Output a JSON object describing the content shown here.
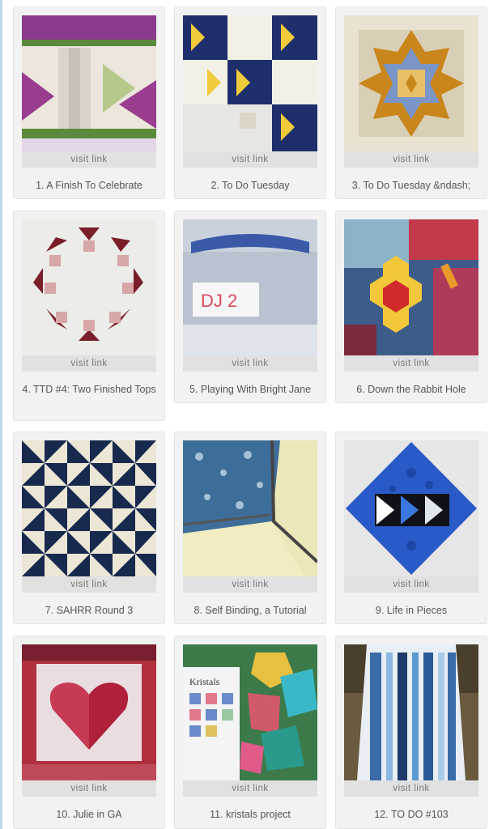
{
  "link_label": "visit link",
  "items": [
    {
      "caption": "1. A Finish To Celebrate",
      "thumb": "quilt-photo"
    },
    {
      "caption": "2. To Do Tuesday",
      "thumb": "quilt-photo"
    },
    {
      "caption": "3. To Do Tuesday &ndash;",
      "thumb": "quilt-photo"
    },
    {
      "caption": "4. TTD #4: Two Finished Tops",
      "thumb": "quilt-photo"
    },
    {
      "caption": "5. Playing With Bright Jane",
      "thumb": "storage-box-photo"
    },
    {
      "caption": "6. Down the Rabbit Hole",
      "thumb": "hexagon-quilt-photo"
    },
    {
      "caption": "7. SAHRR Round 3",
      "thumb": "quilt-photo"
    },
    {
      "caption": "8. Self Binding, a Tutorial",
      "thumb": "fabric-photo"
    },
    {
      "caption": "9. Life in Pieces",
      "thumb": "quilt-photo"
    },
    {
      "caption": "10. Julie in GA",
      "thumb": "heart-quilt-photo"
    },
    {
      "caption": "11. kristals project",
      "thumb": "fabric-pieces-photo"
    },
    {
      "caption": "12. TO DO #103",
      "thumb": "quilt-photo"
    }
  ]
}
